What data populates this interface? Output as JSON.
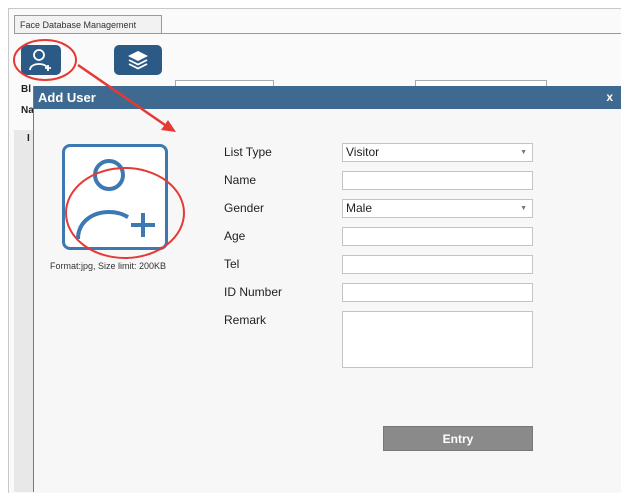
{
  "window": {
    "tab_label": "Face Database Management"
  },
  "toolbar": {
    "add_icon": "add-user-icon",
    "layers_icon": "layers-icon"
  },
  "background": {
    "letter_b": "Bl",
    "letter_n": "Na",
    "letter_i": "I"
  },
  "dialog": {
    "title": "Add User",
    "close_label": "x",
    "photo_hint": "Format:jpg, Size limit: 200KB",
    "form": {
      "list_type_label": "List Type",
      "list_type_value": "Visitor",
      "name_label": "Name",
      "name_value": "",
      "gender_label": "Gender",
      "gender_value": "Male",
      "age_label": "Age",
      "age_value": "",
      "tel_label": "Tel",
      "tel_value": "",
      "id_label": "ID Number",
      "id_value": "",
      "remark_label": "Remark",
      "remark_value": ""
    },
    "entry_label": "Entry"
  },
  "colors": {
    "accent": "#3e6991",
    "annotation": "#e53935",
    "icon_blue": "#3d78b3"
  }
}
